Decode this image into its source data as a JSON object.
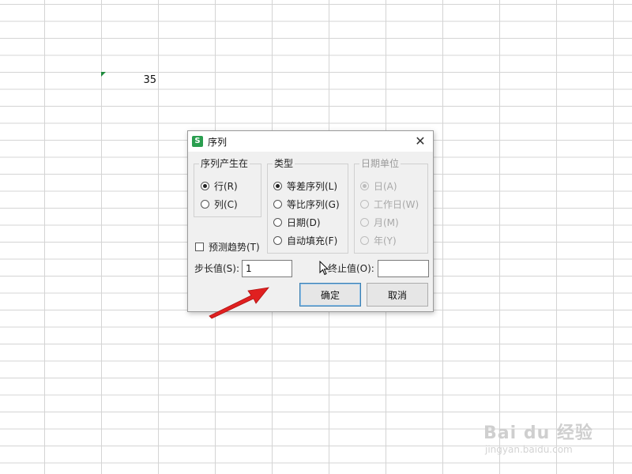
{
  "sheet": {
    "cell_value": "35"
  },
  "dialog": {
    "title": "序列",
    "app_icon": "S",
    "close": "✕",
    "series_in": {
      "legend": "序列产生在",
      "options": [
        "行(R)",
        "列(C)"
      ],
      "selected": 0
    },
    "type": {
      "legend": "类型",
      "options": [
        "等差序列(L)",
        "等比序列(G)",
        "日期(D)",
        "自动填充(F)"
      ],
      "selected": 0
    },
    "date_unit": {
      "legend": "日期单位",
      "options": [
        "日(A)",
        "工作日(W)",
        "月(M)",
        "年(Y)"
      ],
      "selected": 0,
      "disabled": true
    },
    "trend_label": "预测趋势(T)",
    "step_label": "步长值(S):",
    "step_value": "1",
    "stop_label": "终止值(O):",
    "stop_value": "",
    "ok_label": "确定",
    "cancel_label": "取消"
  },
  "watermark": {
    "text": "Bai du 经验",
    "sub": "jingyan.baidu.com"
  },
  "colors": {
    "app_icon": "#2a9e4f",
    "arrow": "#e02020",
    "grid": "#d4d4d4"
  }
}
